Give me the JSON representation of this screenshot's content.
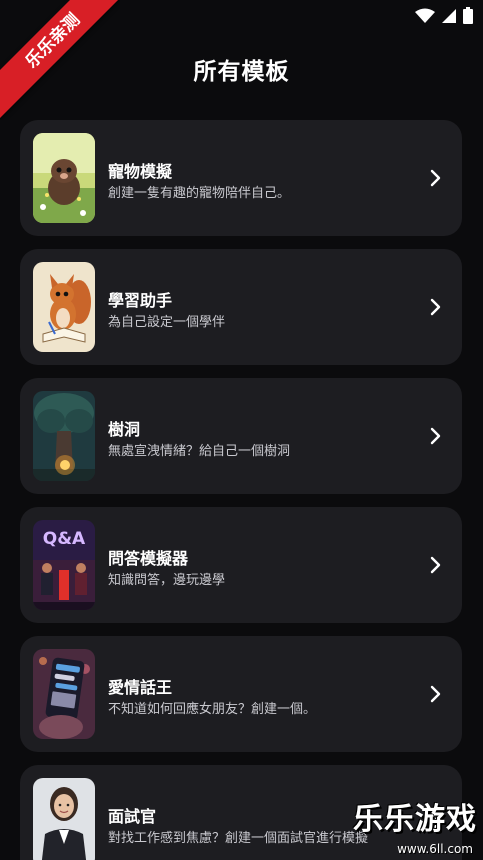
{
  "header": {
    "title": "所有模板"
  },
  "templates": [
    {
      "title": "寵物模擬",
      "desc": "創建一隻有趣的寵物陪伴自己。",
      "image": "cute-mole-pet-image"
    },
    {
      "title": "學習助手",
      "desc": "為自己設定一個學伴",
      "image": "squirrel-reading-image"
    },
    {
      "title": "樹洞",
      "desc": "無處宣洩情緒？給自己一個樹洞",
      "image": "glowing-tree-hollow-image"
    },
    {
      "title": "問答模擬器",
      "desc": "知識問答，邊玩邊學",
      "image": "qa-show-image",
      "image_text": "Q&A"
    },
    {
      "title": "愛情話王",
      "desc": "不知道如何回應女朋友？創建一個。",
      "image": "phone-chat-image"
    },
    {
      "title": "面試官",
      "desc": "對找工作感到焦慮？創建一個面試官進行模擬",
      "image": "interviewer-portrait-image"
    }
  ],
  "watermark": {
    "ribbon": "乐乐亲测",
    "brand": "乐乐游戏",
    "url": "www.6ll.com"
  },
  "colors": {
    "background": "#0b0b0d",
    "card": "#1d1d21",
    "ribbon": "#d81f26"
  }
}
